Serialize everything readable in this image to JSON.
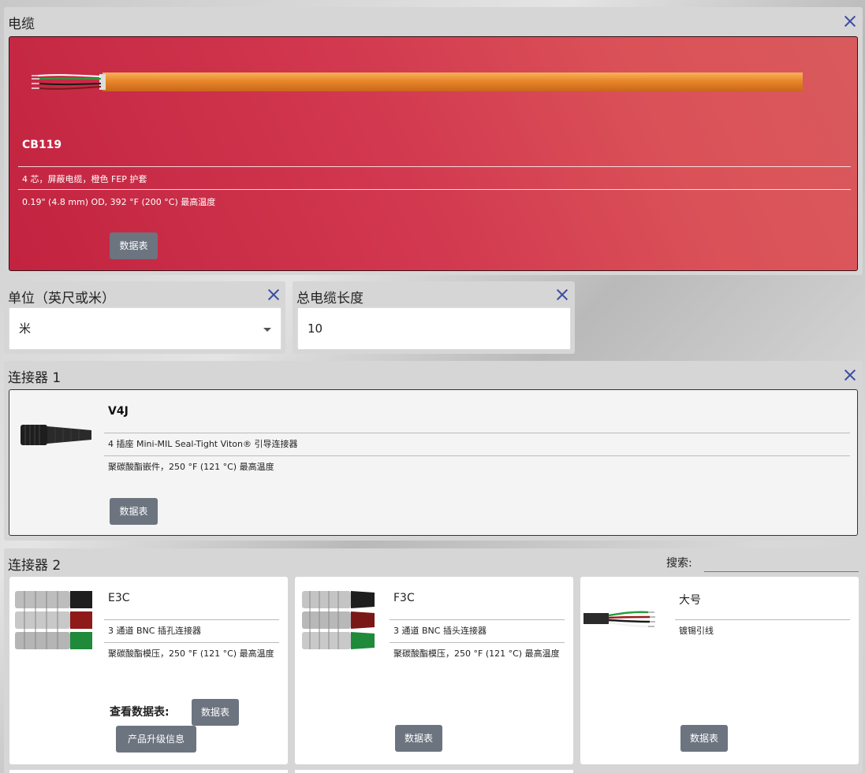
{
  "cable": {
    "title": "电缆",
    "name": "CB119",
    "desc1": "4 芯，屏蔽电缆，橙色 FEP 护套",
    "desc2": "0.19\" (4.8 mm) OD, 392 °F (200 °C) 最高温度",
    "datasheet": "数据表"
  },
  "units": {
    "title": "单位（英尺或米）",
    "value": "米"
  },
  "length": {
    "title": "总电缆长度",
    "value": "10"
  },
  "connector1": {
    "title": "连接器 1",
    "name": "V4J",
    "desc1": "4 插座 Mini-MIL Seal-Tight Viton® 引导连接器",
    "desc2": "聚碳酸酯嵌件，250 °F (121 °C) 最高温度",
    "datasheet": "数据表"
  },
  "connector2": {
    "title": "连接器 2",
    "search_label": "搜索:",
    "options": [
      {
        "name": "E3C",
        "desc1": "3 通道 BNC 插孔连接器",
        "desc2": "聚碳酸酯模压，250 °F (121 °C) 最高温度",
        "view_label": "查看数据表:",
        "datasheet": "数据表",
        "upgrade": "产品升级信息"
      },
      {
        "name": "F3C",
        "desc1": "3 通道 BNC 插头连接器",
        "desc2": "聚碳酸酯模压，250 °F (121 °C) 最高温度",
        "datasheet": "数据表"
      },
      {
        "name": "大号",
        "desc1": "镀锡引线",
        "datasheet": "数据表"
      }
    ]
  },
  "colors": {
    "cable_card_bg": "#c22340",
    "close_icon": "#3d4fa6",
    "button_bg": "#6c7480",
    "cable_jacket": "#e8862a"
  }
}
